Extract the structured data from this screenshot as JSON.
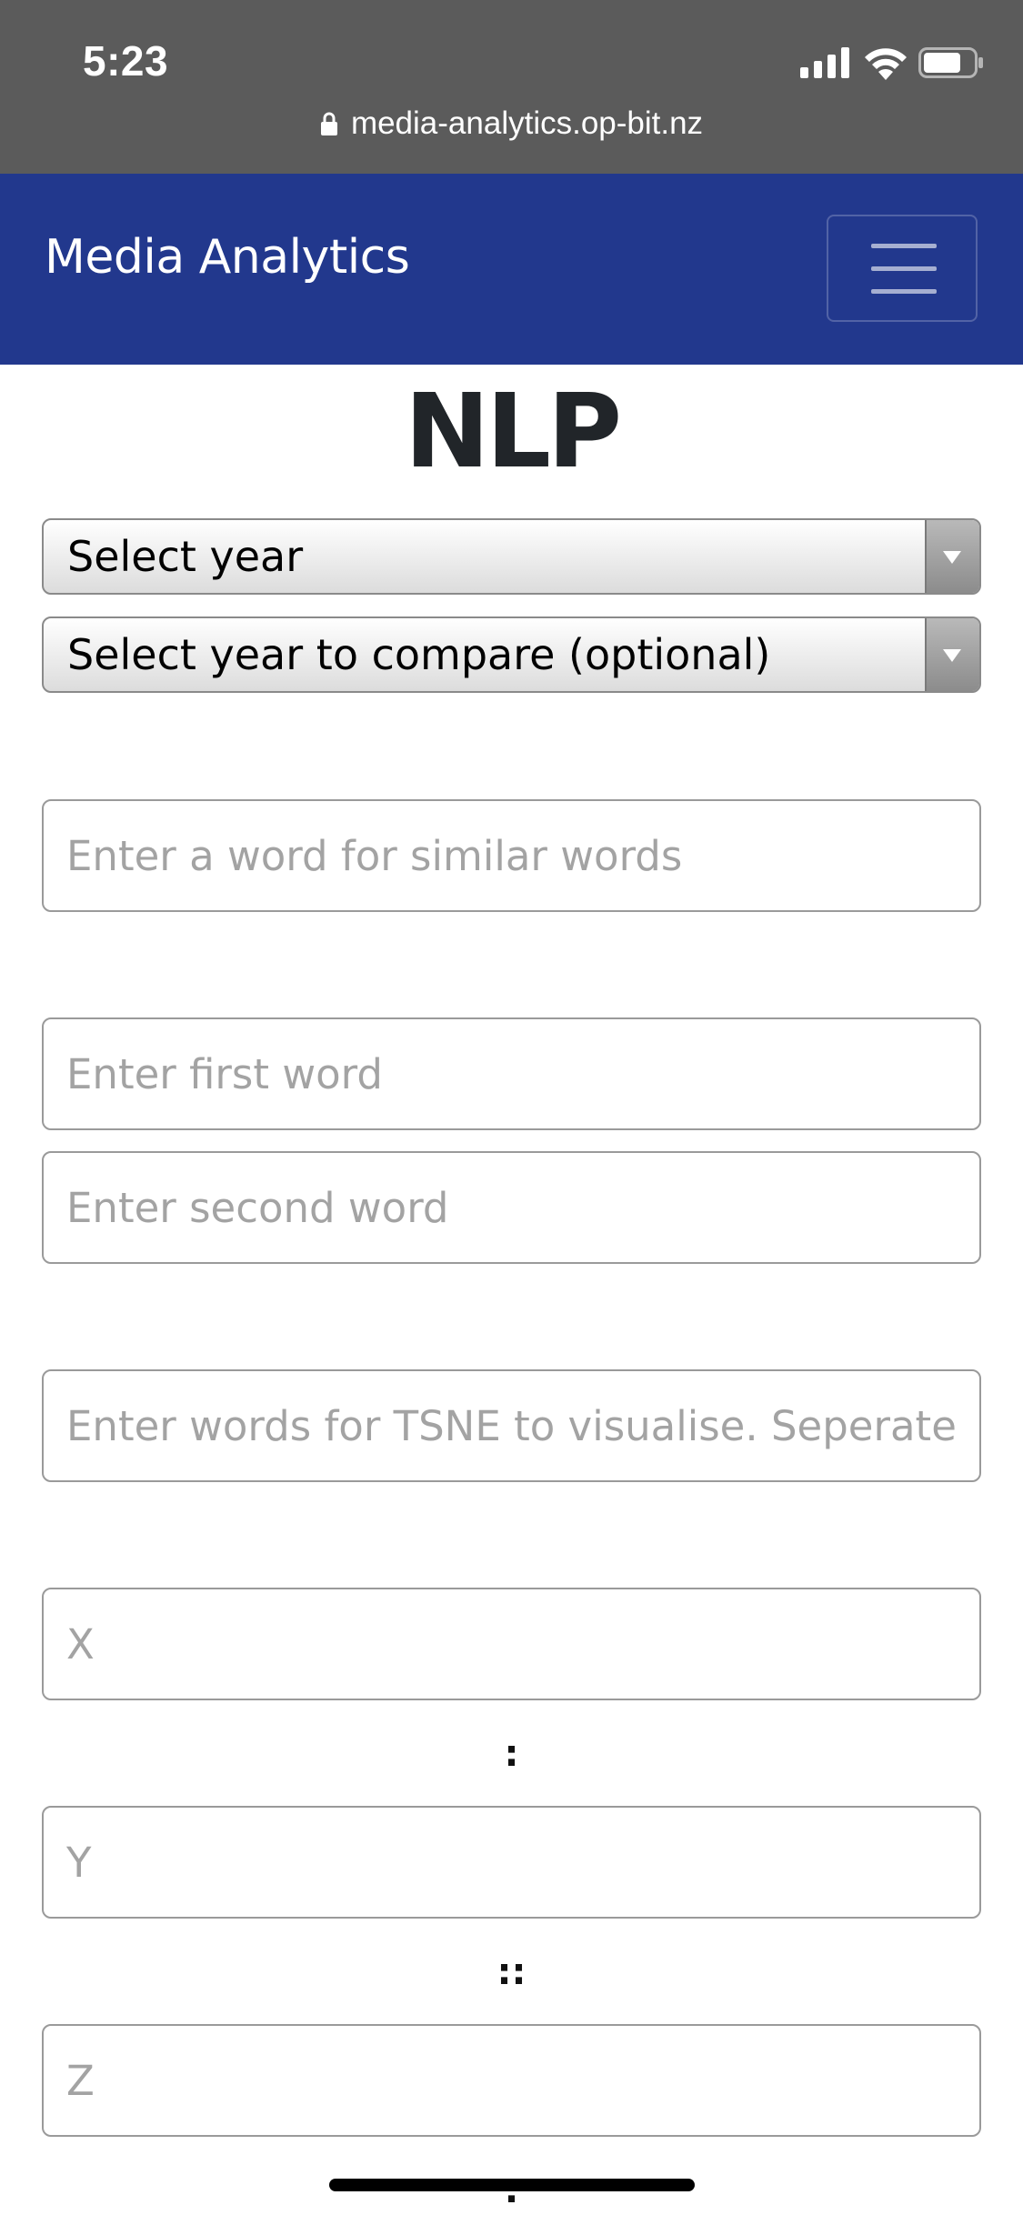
{
  "status_bar": {
    "time": "5:23",
    "url": "media-analytics.op-bit.nz",
    "icons": [
      "signal-icon",
      "wifi-icon",
      "battery-icon",
      "lock-icon"
    ]
  },
  "navbar": {
    "brand": "Media Analytics",
    "background_color": "#22388d",
    "menu_icon": "hamburger-menu-icon"
  },
  "page": {
    "title": "NLP"
  },
  "selects": {
    "year": "Select year",
    "compare_year": "Select year to compare (optional)"
  },
  "inputs": {
    "similar_words_placeholder": "Enter a word for similar words",
    "first_word_placeholder": "Enter first word",
    "second_word_placeholder": "Enter second word",
    "tsne_placeholder": "Enter words for TSNE to visualise. Seperate words with commas",
    "x_placeholder": "X",
    "y_placeholder": "Y",
    "z_placeholder": "Z"
  },
  "analogy": {
    "separator_1": ":",
    "separator_2": "::",
    "separator_3": ":"
  }
}
